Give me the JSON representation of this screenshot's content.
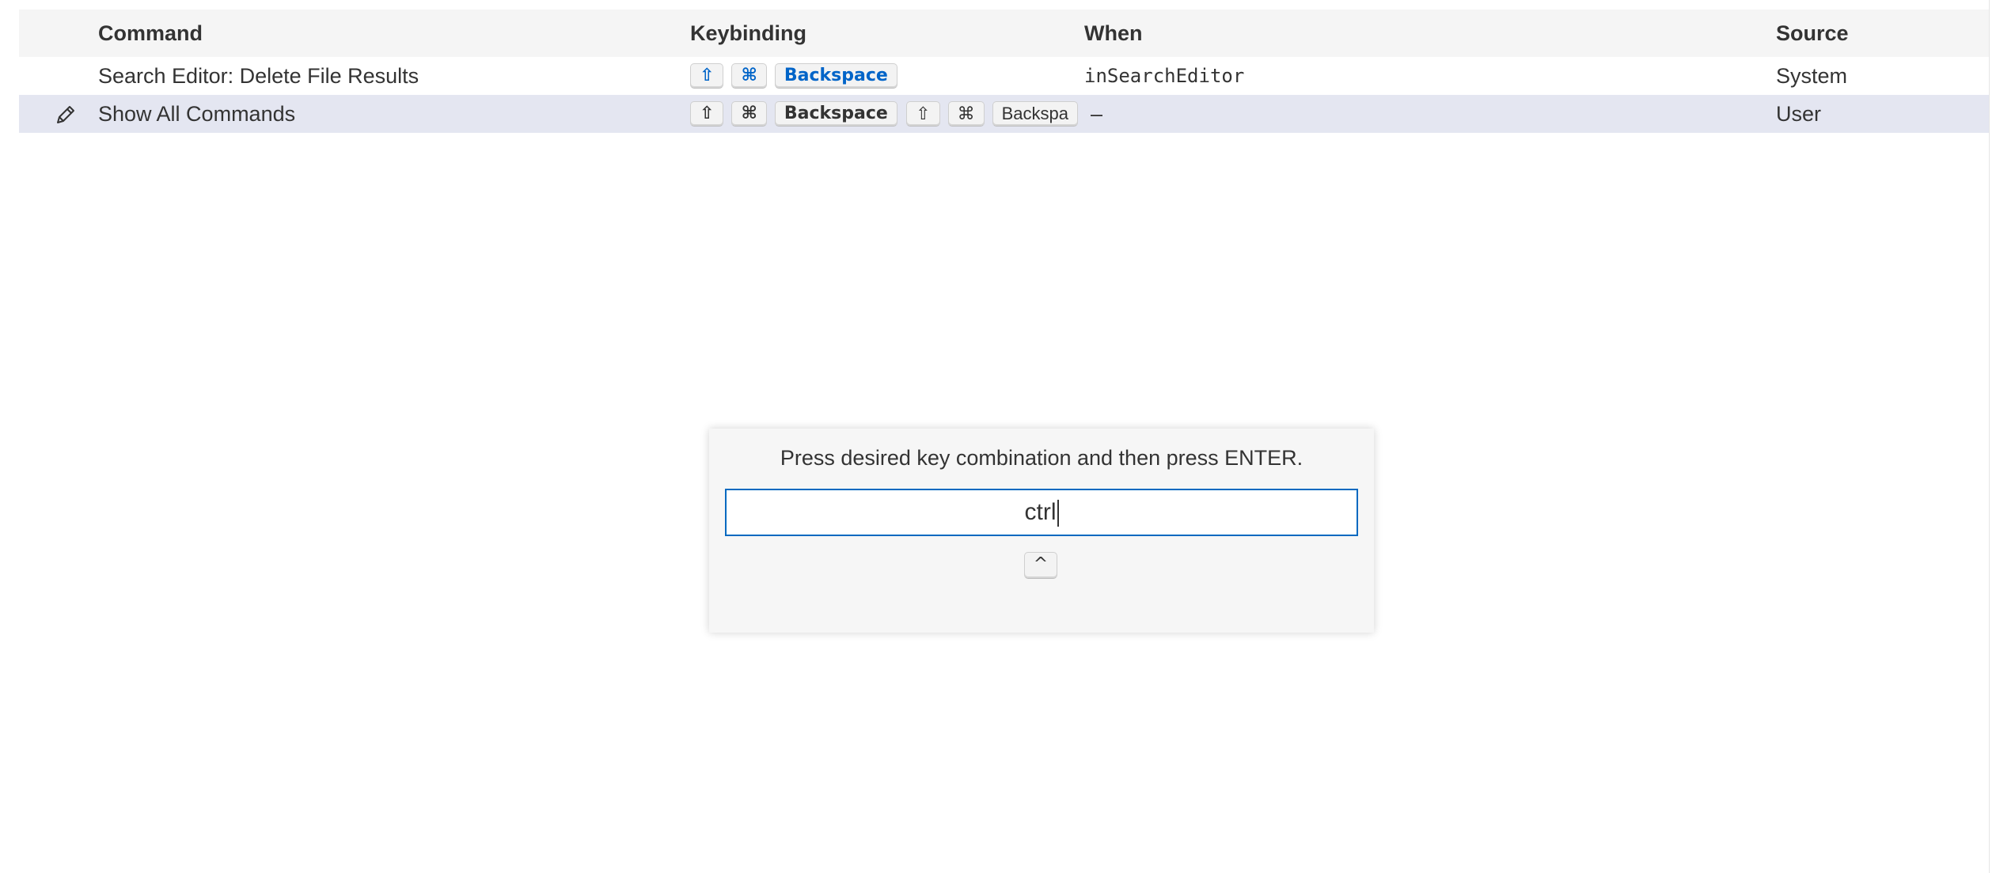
{
  "table": {
    "headers": {
      "command": "Command",
      "keybinding": "Keybinding",
      "when": "When",
      "source": "Source"
    },
    "rows": [
      {
        "command": "Search Editor: Delete File Results",
        "keys": [
          "⇧",
          "⌘",
          "Backspace"
        ],
        "when": "inSearchEditor",
        "source": "System"
      },
      {
        "command": "Show All Commands",
        "keys": [
          "⇧",
          "⌘",
          "Backspace"
        ],
        "keys_chord2": [
          "⇧",
          "⌘",
          "Backspa"
        ],
        "when": "–",
        "source": "User",
        "edit_icon": "pencil-icon"
      }
    ]
  },
  "dialog": {
    "message": "Press desired key combination and then press ENTER.",
    "input_value": "ctrl",
    "chord_key": "^"
  },
  "colors": {
    "header_bg": "#f5f5f5",
    "focused_row_bg": "#e4e6f1",
    "input_border": "#0069c0",
    "highlight_key_text": "#0064c8"
  }
}
